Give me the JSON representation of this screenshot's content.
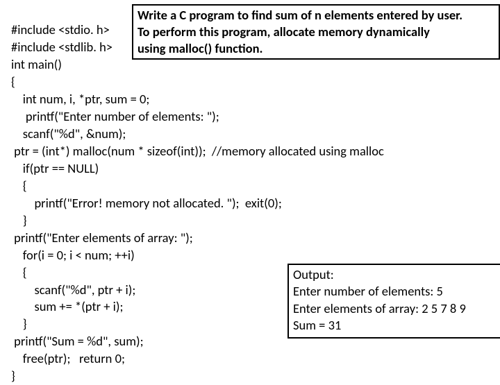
{
  "code": {
    "l1": "#include <stdio. h>",
    "l2": "#include <stdlib. h>",
    "l3": "int main()",
    "l4": "{",
    "l5": "    int num, i, *ptr, sum = 0;",
    "l6": "     printf(\"Enter number of elements: \");",
    "l7": "    scanf(\"%d\", &num);",
    "l8": " ptr = (int*) malloc(num * sizeof(int));  //memory allocated using malloc",
    "l9": "    if(ptr == NULL)",
    "l10": "    {",
    "l11": "        printf(\"Error! memory not allocated. \");  exit(0);",
    "l12": "    }",
    "l13": " printf(\"Enter elements of array: \");",
    "l14": "    for(i = 0; i < num; ++i)",
    "l15": "    {",
    "l16": "        scanf(\"%d\", ptr + i);",
    "l17": "        sum += *(ptr + i);",
    "l18": "    }",
    "l19": " printf(\"Sum = %d\", sum);",
    "l20": "    free(ptr);   return 0;",
    "l21": "}"
  },
  "prompt": {
    "l1": "Write a C program to find sum of n elements entered by user.",
    "l2": "To perform this program, allocate memory dynamically",
    "l3": "using malloc() function."
  },
  "output": {
    "l1": "Output:",
    "l2": "Enter number of elements: 5",
    "l3": " Enter elements of array:  2 5 7 8 9",
    "l4": " Sum = 31"
  }
}
